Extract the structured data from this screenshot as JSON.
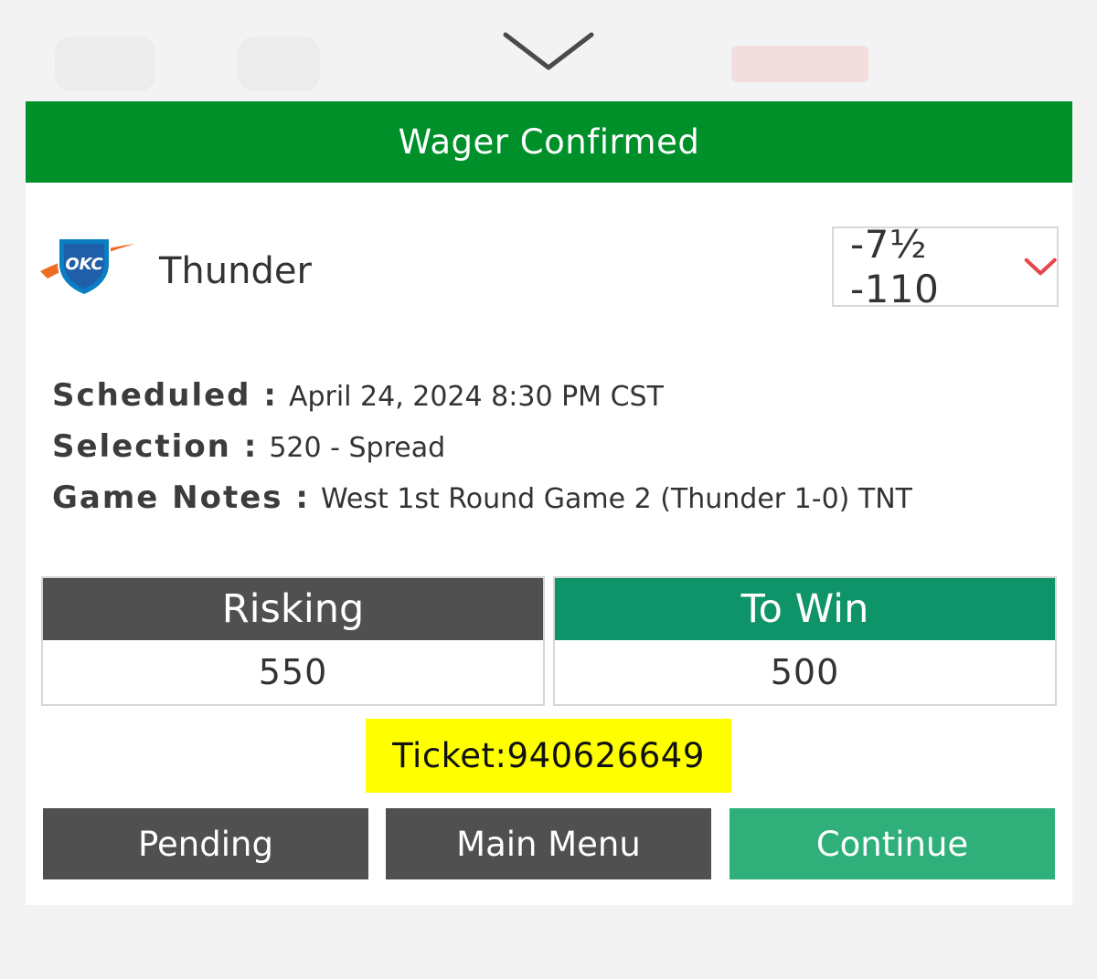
{
  "header": {
    "title": "Wager Confirmed"
  },
  "bet": {
    "team": "Thunder",
    "logo_text": "OKC",
    "line": "-7½ -110"
  },
  "details": [
    {
      "key": "Scheduled :",
      "value": "April 24, 2024 8:30 PM CST"
    },
    {
      "key": "Selection :",
      "value": "520 - Spread"
    },
    {
      "key": "Game Notes :",
      "value": "West 1st Round Game 2 (Thunder 1-0) TNT"
    }
  ],
  "amounts": {
    "risking_label": "Risking",
    "risking_value": "550",
    "towin_label": "To Win",
    "towin_value": "500"
  },
  "ticket": {
    "text": "Ticket:940626649"
  },
  "buttons": {
    "pending": "Pending",
    "main_menu": "Main Menu",
    "continue": "Continue"
  },
  "colors": {
    "header_green": "#00902a",
    "to_win_green": "#0f946a",
    "continue_green": "#2fb07b",
    "dark_gray": "#505050",
    "ticket_yellow": "#ffff00",
    "chevron_red": "#e8464a"
  },
  "icons": {
    "collapse": "chevron-down-icon",
    "odds_dropdown": "chevron-down-icon",
    "team": "okc-thunder-logo"
  }
}
